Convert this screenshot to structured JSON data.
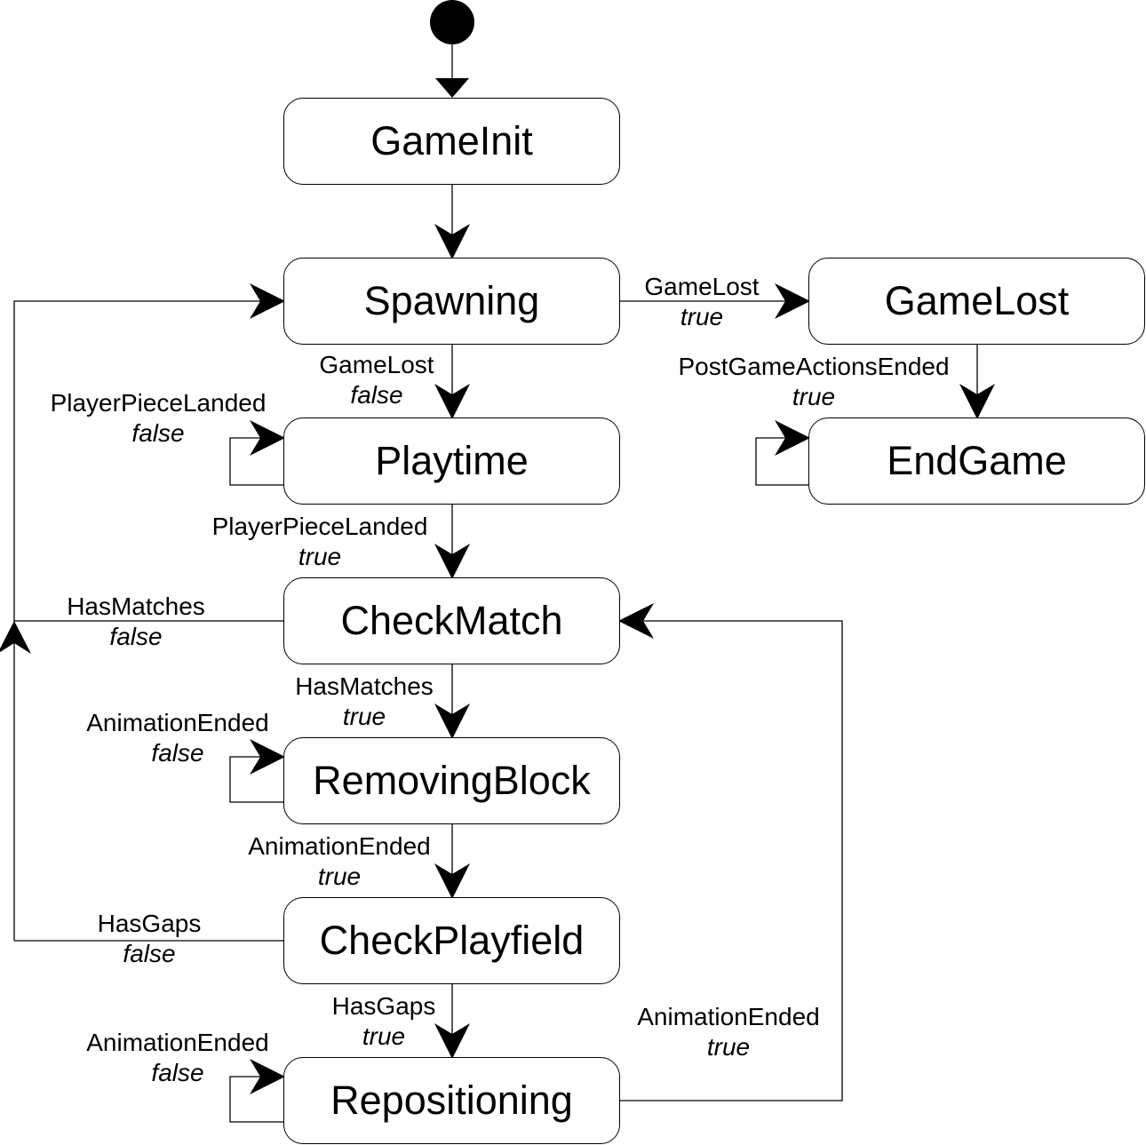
{
  "diagram": {
    "type": "state-machine",
    "initial_state": "GameInit",
    "colors": {
      "stroke": "#000000",
      "background": "#ffffff",
      "arrow_fill": "#000000"
    },
    "states": [
      {
        "id": "GameInit",
        "label": "GameInit"
      },
      {
        "id": "Spawning",
        "label": "Spawning"
      },
      {
        "id": "GameLost",
        "label": "GameLost"
      },
      {
        "id": "Playtime",
        "label": "Playtime"
      },
      {
        "id": "EndGame",
        "label": "EndGame"
      },
      {
        "id": "CheckMatch",
        "label": "CheckMatch"
      },
      {
        "id": "RemovingBlock",
        "label": "RemovingBlock"
      },
      {
        "id": "CheckPlayfield",
        "label": "CheckPlayfield"
      },
      {
        "id": "Repositioning",
        "label": "Repositioning"
      }
    ],
    "transitions": [
      {
        "from": "start",
        "to": "GameInit",
        "trigger": "",
        "condition": ""
      },
      {
        "from": "GameInit",
        "to": "Spawning",
        "trigger": "",
        "condition": ""
      },
      {
        "from": "Spawning",
        "to": "GameLost",
        "trigger": "GameLost",
        "condition": "true"
      },
      {
        "from": "GameLost",
        "to": "EndGame",
        "trigger": "PostGameActionsEnded",
        "condition": "true"
      },
      {
        "from": "EndGame",
        "to": "EndGame",
        "trigger": "",
        "condition": ""
      },
      {
        "from": "Spawning",
        "to": "Playtime",
        "trigger": "GameLost",
        "condition": "false"
      },
      {
        "from": "Playtime",
        "to": "Playtime",
        "trigger": "PlayerPieceLanded",
        "condition": "false"
      },
      {
        "from": "Playtime",
        "to": "CheckMatch",
        "trigger": "PlayerPieceLanded",
        "condition": "true"
      },
      {
        "from": "CheckMatch",
        "to": "Spawning",
        "trigger": "HasMatches",
        "condition": "false"
      },
      {
        "from": "CheckMatch",
        "to": "RemovingBlock",
        "trigger": "HasMatches",
        "condition": "true"
      },
      {
        "from": "RemovingBlock",
        "to": "RemovingBlock",
        "trigger": "AnimationEnded",
        "condition": "false"
      },
      {
        "from": "RemovingBlock",
        "to": "CheckPlayfield",
        "trigger": "AnimationEnded",
        "condition": "true"
      },
      {
        "from": "CheckPlayfield",
        "to": "Spawning",
        "trigger": "HasGaps",
        "condition": "false"
      },
      {
        "from": "CheckPlayfield",
        "to": "Repositioning",
        "trigger": "HasGaps",
        "condition": "true"
      },
      {
        "from": "Repositioning",
        "to": "Repositioning",
        "trigger": "AnimationEnded",
        "condition": "false"
      },
      {
        "from": "Repositioning",
        "to": "CheckMatch",
        "trigger": "AnimationEnded",
        "condition": "true"
      }
    ]
  }
}
